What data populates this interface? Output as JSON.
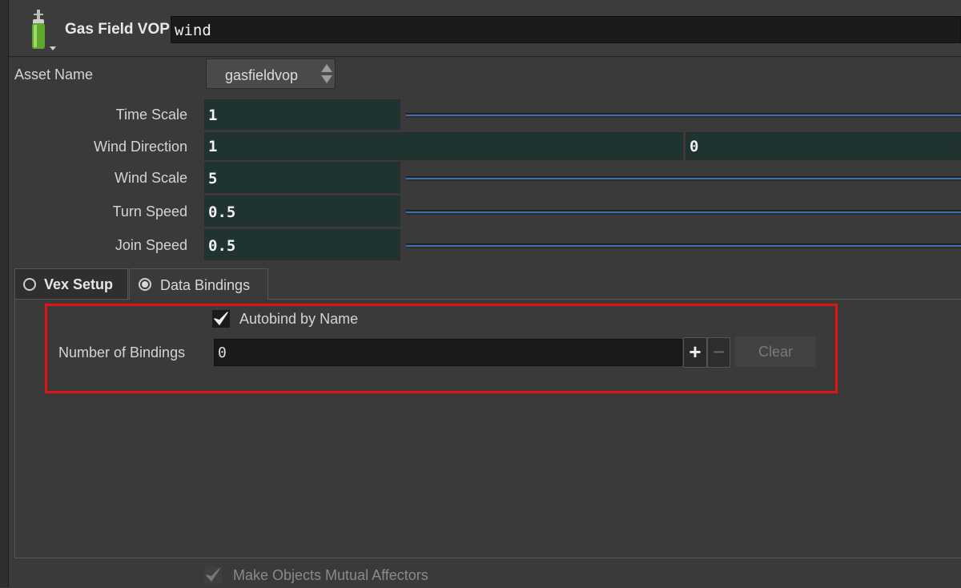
{
  "header": {
    "node_type": "Gas Field VOP",
    "node_name": "wind"
  },
  "parameters": {
    "asset_name_label": "Asset Name",
    "asset_name_value": "gasfieldvop",
    "time_scale": {
      "label": "Time Scale",
      "value": "1",
      "slider_fraction": 1.0
    },
    "wind_direction": {
      "label": "Wind Direction",
      "value_x": "1",
      "value_y": "0"
    },
    "wind_scale": {
      "label": "Wind Scale",
      "value": "5",
      "slider_fraction": 1.0
    },
    "turn_speed": {
      "label": "Turn Speed",
      "value": "0.5",
      "slider_fraction": 1.0
    },
    "join_speed": {
      "label": "Join Speed",
      "value": "0.5",
      "slider_fraction": 1.0
    }
  },
  "tabs": [
    {
      "label": "Vex Setup",
      "selected": false
    },
    {
      "label": "Data Bindings",
      "selected": true
    }
  ],
  "data_bindings": {
    "autobind_label": "Autobind by Name",
    "autobind_checked": true,
    "num_bindings_label": "Number of Bindings",
    "num_bindings_value": "0",
    "plus_label": "+",
    "minus_label": "−",
    "clear_label": "Clear"
  },
  "footer": {
    "mutual_affectors_label": "Make Objects Mutual Affectors",
    "mutual_affectors_checked": true
  },
  "colors": {
    "highlight_border": "#e01515",
    "slider_fill": "#3c6fb0",
    "number_field_bg": "#1f3331"
  }
}
